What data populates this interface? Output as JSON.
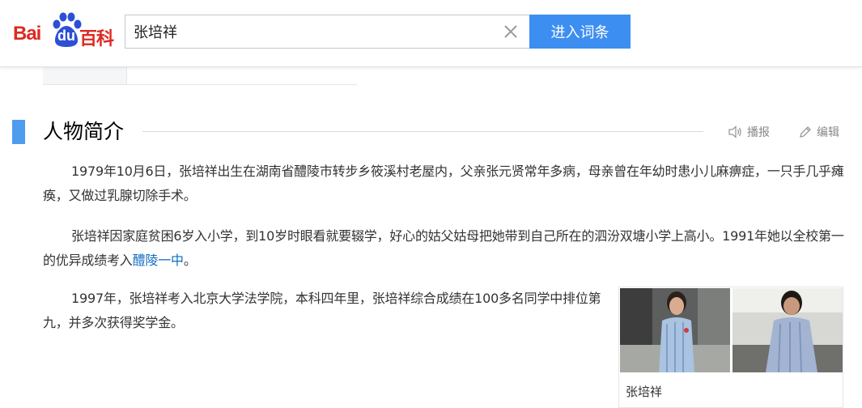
{
  "header": {
    "logo": {
      "text_bai": "Bai",
      "text_du": "du",
      "text_baike": "百科"
    },
    "search": {
      "value": "张培祥"
    },
    "submit_label": "进入词条",
    "clear_icon": "close-icon"
  },
  "section": {
    "title": "人物简介",
    "play_label": "播报",
    "edit_label": "编辑",
    "marker_color": "#4f9cee"
  },
  "content": {
    "p1": "1979年10月6日，张培祥出生在湖南省醴陵市转步乡筱溪村老屋内，父亲张元贤常年多病，母亲曾在年幼时患小儿麻痹症，一只手几乎瘫痪，又做过乳腺切除手术。",
    "p2_text": "张培祥因家庭贫困6岁入小学，到10岁时眼看就要辍学，好心的姑父姑母把她带到自己所在的泗汾双塘小学上高小。1991年她以全校第一的优异成绩考入",
    "p2_link": "醴陵一中",
    "p2_end": "。",
    "p3": "1997年，张培祥考入北京大学法学院，本科四年里，张培祥综合成绩在100多名同学中排位第九，并多次获得奖学金。"
  },
  "photo": {
    "caption": "张培祥"
  },
  "colors": {
    "brand_red": "#de2921",
    "button_blue": "#3d8ef1",
    "link_blue": "#136ec2"
  }
}
